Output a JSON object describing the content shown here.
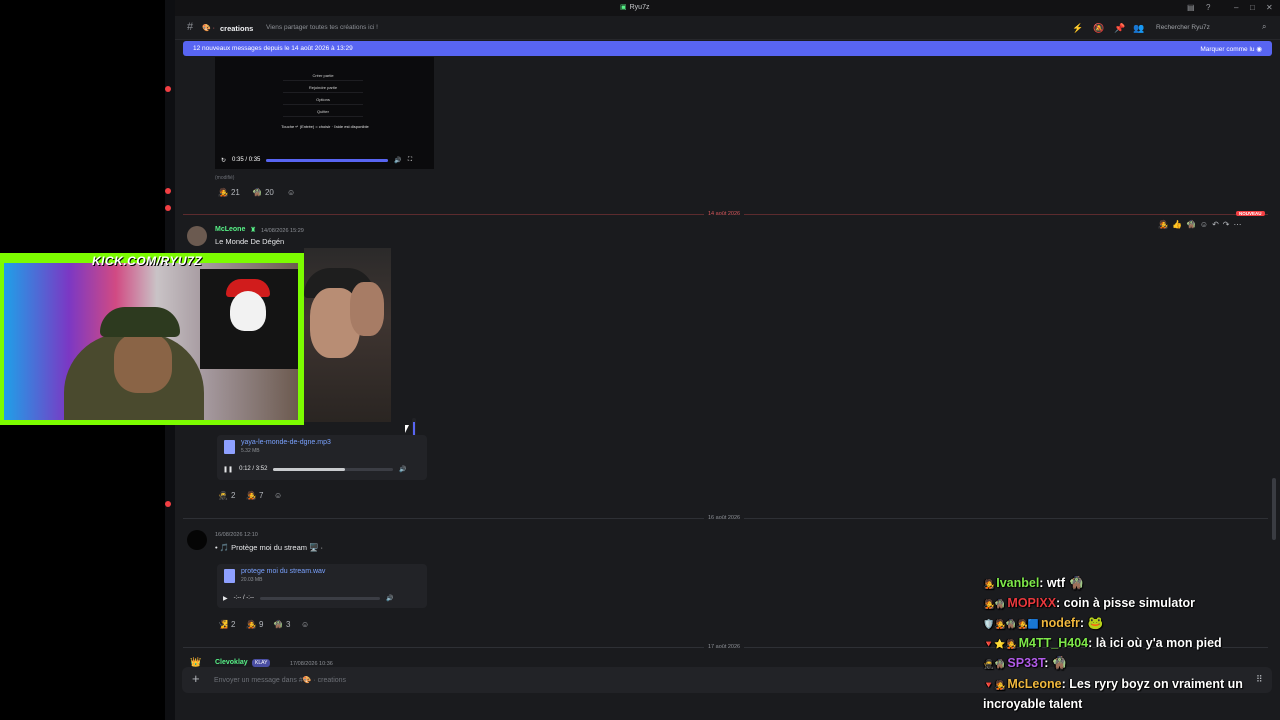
{
  "window": {
    "title": "Ryu7z"
  },
  "channel": {
    "name": "creations",
    "topic": "Viens partager toutes tes créations ici !",
    "search_placeholder": "Rechercher Ryu7z"
  },
  "new_messages_bar": {
    "text": "12 nouveaux messages depuis le 14 août 2026 à 13:29",
    "mark_read": "Marquer comme lu"
  },
  "video_embed": {
    "menu_items": [
      "Créer partie",
      "Rejoindre partie",
      "Options",
      "Quitter"
    ],
    "hint": "Touche ↵ (Entrée) = choisir · l'aide est disponible",
    "time": "0:35 / 0:35",
    "progress": 1.0,
    "edited": "(modifié)",
    "reactions": [
      {
        "emoji": "🧑‍🎤",
        "count": "21"
      },
      {
        "emoji": "🧌",
        "count": "20"
      }
    ]
  },
  "dividers": {
    "d1": "14 août 2026",
    "new_badge": "NOUVEAU",
    "d2": "16 août 2026",
    "d3": "17 août 2026"
  },
  "messages": {
    "m1": {
      "username": "McLeone",
      "timestamp": "14/08/2026 15:29",
      "text": "Le Monde De Dégén",
      "attachment": {
        "name": "yaya-le-monde-de-dgne.mp3",
        "size": "5.32 MB",
        "time": "0:12 / 3:52",
        "progress": 0.6
      },
      "reactions": [
        {
          "emoji": "🥷",
          "count": "2"
        },
        {
          "emoji": "🧑‍🎤",
          "count": "7"
        }
      ]
    },
    "m2": {
      "timestamp": "16/08/2026 12:10",
      "text": "🎵 Protège moi du stream 🖥️ ·",
      "attachment": {
        "name": "protege moi du stream.wav",
        "size": "20.03 MB",
        "time": "-:-- / -:--",
        "progress": 0.0
      },
      "reactions": [
        {
          "emoji": "🧏",
          "count": "2"
        },
        {
          "emoji": "🧑‍🎤",
          "count": "9"
        },
        {
          "emoji": "🧌",
          "count": "3"
        }
      ]
    },
    "m3": {
      "username": "Clevoklay",
      "tag": "KLAY",
      "timestamp": "17/08/2026 10:36"
    }
  },
  "composer": {
    "placeholder": "Envoyer un message dans #🎨 · creations"
  },
  "stream_overlay": {
    "banner": "KICK.COM/RYU7Z"
  },
  "stream_chat": [
    {
      "badges": "🧑‍🎤",
      "user": "Ivanbel",
      "color": "#7ee84a",
      "text": ": wtf 🧌"
    },
    {
      "badges": "🧑‍🎤🧌",
      "user": "MOPIXX",
      "color": "#e8383d",
      "text": ": coin à pisse simulator"
    },
    {
      "badges": "🛡️🧑‍🎤🧌🧑‍🎤🟦",
      "user": "nodefr",
      "color": "#f0b83e",
      "text": ": 🐸"
    },
    {
      "badges": "🔻⭐🧑‍🎤",
      "user": "M4TT_H404",
      "color": "#7ee84a",
      "text": ": là ici où y'a mon pied"
    },
    {
      "badges": "🥷🧌",
      "user": "SP33T",
      "color": "#b15be8",
      "text": ": 🧌"
    },
    {
      "badges": "🔻🧑‍🎤",
      "user": "McLeone",
      "color": "#f0b83e",
      "text": ": Les ryry boyz on vraiment un"
    },
    {
      "badges": "",
      "user": "",
      "color": "#ffffff",
      "text": "incroyable talent"
    }
  ]
}
